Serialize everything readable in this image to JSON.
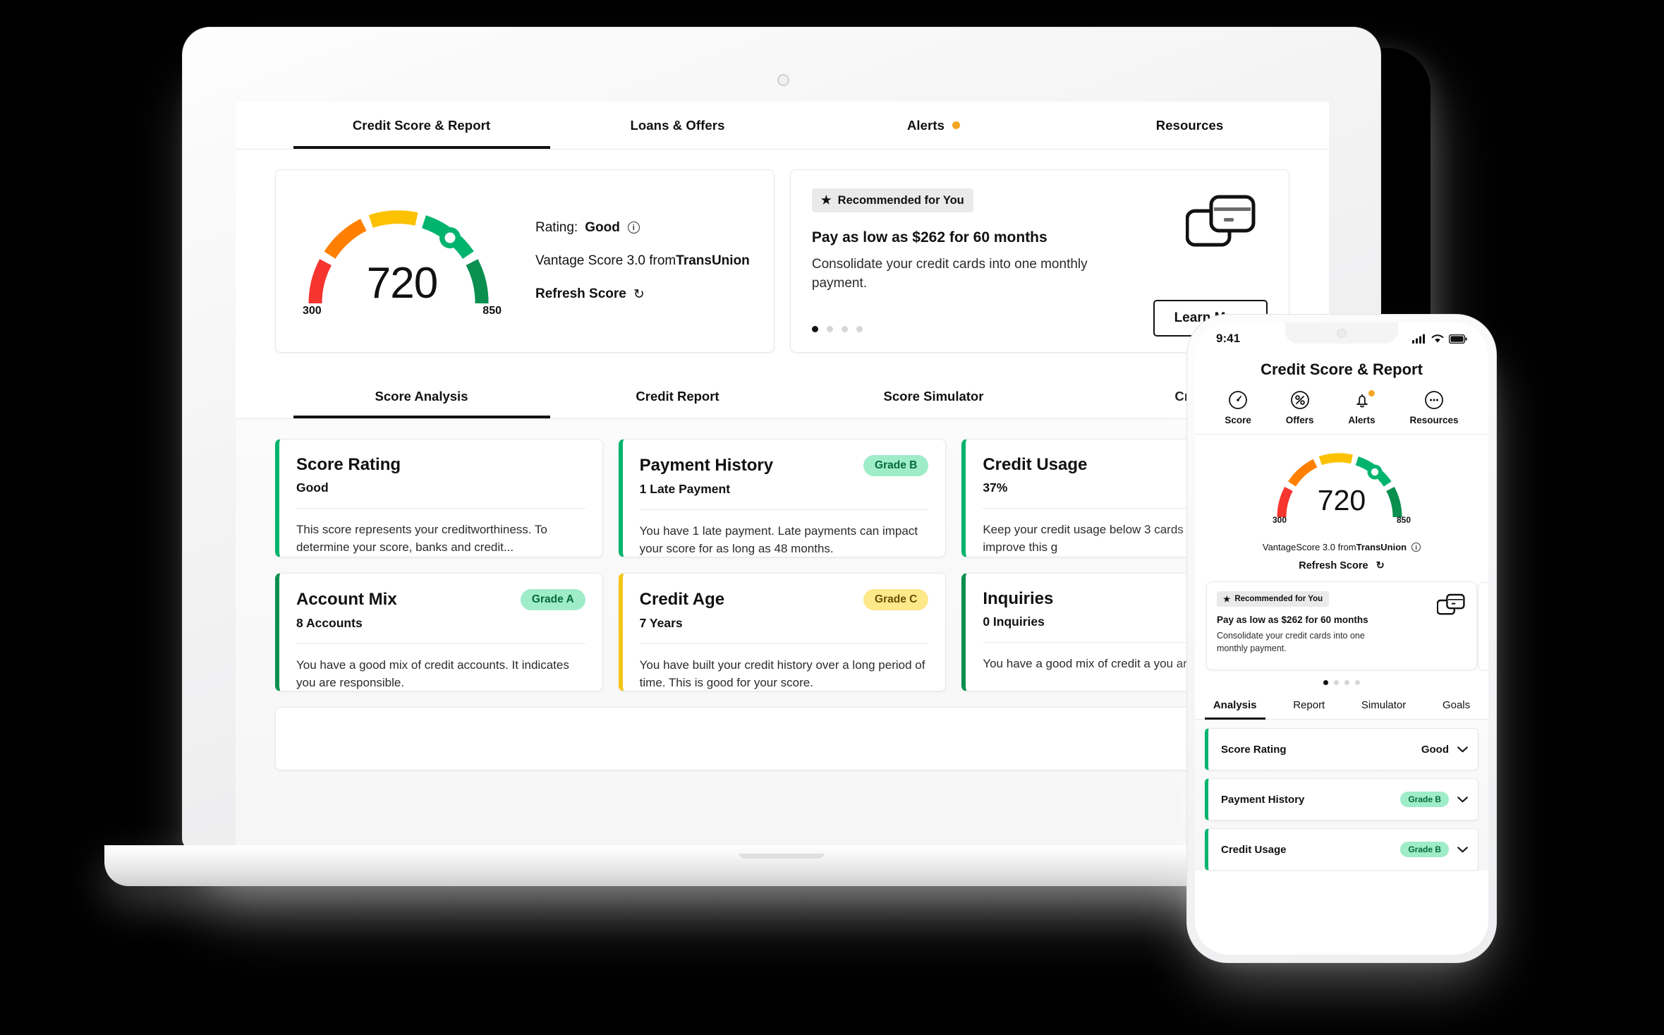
{
  "desktop": {
    "top_tabs": [
      {
        "label": "Credit Score & Report",
        "active": true,
        "dot": false
      },
      {
        "label": "Loans & Offers",
        "active": false,
        "dot": false
      },
      {
        "label": "Alerts",
        "active": false,
        "dot": true
      },
      {
        "label": "Resources",
        "active": false,
        "dot": false
      }
    ],
    "score_panel": {
      "score": "720",
      "min_label": "300",
      "max_label": "850",
      "rating_label": "Rating:",
      "rating_value": "Good",
      "info_icon": "info-icon",
      "bureau_text_light": "Vantage Score 3.0 from ",
      "bureau_text_bold": "TransUnion",
      "refresh_label": "Refresh Score",
      "refresh_icon": "refresh-icon"
    },
    "offer_panel": {
      "badge_icon": "star-icon",
      "badge_label": "Recommended for You",
      "title": "Pay as low as $262 for 60 months",
      "description": "Consolidate your credit cards into one monthly payment.",
      "cta_label": "Learn More",
      "card_icon": "credit-cards-icon",
      "dots_total": 4,
      "dots_active": 1
    },
    "sub_tabs": [
      {
        "label": "Score Analysis",
        "active": true
      },
      {
        "label": "Credit Report",
        "active": false
      },
      {
        "label": "Score Simulator",
        "active": false
      },
      {
        "label": "Cred",
        "active": false
      }
    ],
    "factor_cards": [
      {
        "title": "Score Rating",
        "value": "Good",
        "grade": "",
        "accent": "#00b46e",
        "grade_bg": "",
        "grade_fg": "",
        "description": "This score represents your creditworthiness. To determine your score, banks and credit..."
      },
      {
        "title": "Payment History",
        "value": "1 Late Payment",
        "grade": "Grade B",
        "accent": "#00b46e",
        "grade_bg": "#9fecc8",
        "grade_fg": "#056b38",
        "description": "You have 1 late payment. Late payments can impact your score for as long as 48 months."
      },
      {
        "title": "Credit Usage",
        "value": "37%",
        "grade": "",
        "accent": "#00b46e",
        "grade_bg": "",
        "grade_fg": "",
        "description": "Keep your credit usage below 3 cards in order to improve this g"
      },
      {
        "title": "Account Mix",
        "value": "8 Accounts",
        "grade": "Grade A",
        "accent": "#0a8f4f",
        "grade_bg": "#9fecc8",
        "grade_fg": "#056b38",
        "description": "You have a good mix of credit accounts. It indicates you are responsible."
      },
      {
        "title": "Credit Age",
        "value": "7 Years",
        "grade": "Grade C",
        "accent": "#f5c518",
        "grade_bg": "#fde88a",
        "grade_fg": "#6b4e05",
        "description": "You have built your credit history over a long period of time. This is good for your score."
      },
      {
        "title": "Inquiries",
        "value": "0 Inquiries",
        "grade": "",
        "accent": "#0a8f4f",
        "grade_bg": "",
        "grade_fg": "",
        "description": "You have a good mix of credit a you are responsible."
      }
    ]
  },
  "phone": {
    "status": {
      "time": "9:41",
      "signal_icon": "cellular-signal-icon",
      "wifi_icon": "wifi-icon",
      "battery_icon": "battery-icon"
    },
    "title": "Credit Score & Report",
    "nav_icons": [
      {
        "label": "Score",
        "icon": "speedometer-icon",
        "badge": false
      },
      {
        "label": "Offers",
        "icon": "percent-icon",
        "badge": false
      },
      {
        "label": "Alerts",
        "icon": "bell-icon",
        "badge": true
      },
      {
        "label": "Resources",
        "icon": "ellipsis-icon",
        "badge": false
      }
    ],
    "score_panel": {
      "score": "720",
      "min_label": "300",
      "max_label": "850",
      "bureau_text_light": "VantageScore 3.0 from ",
      "bureau_text_bold": "TransUnion",
      "info_icon": "info-icon",
      "refresh_label": "Refresh Score",
      "refresh_icon": "refresh-icon"
    },
    "offer": {
      "badge_icon": "star-icon",
      "badge_label": "Recommended for You",
      "title": "Pay as low as $262 for 60 months",
      "description": "Consolidate your credit cards into one monthly payment.",
      "card_icon": "credit-cards-icon",
      "dots_total": 4,
      "dots_active": 1
    },
    "tabs": [
      {
        "label": "Analysis",
        "active": true
      },
      {
        "label": "Report",
        "active": false
      },
      {
        "label": "Simulator",
        "active": false
      },
      {
        "label": "Goals",
        "active": false
      }
    ],
    "rows": [
      {
        "title": "Score Rating",
        "value": "Good",
        "grade": "",
        "accent": "#00b46e",
        "grade_bg": "",
        "grade_fg": ""
      },
      {
        "title": "Payment History",
        "value": "",
        "grade": "Grade B",
        "accent": "#00b46e",
        "grade_bg": "#9fecc8",
        "grade_fg": "#056b38"
      },
      {
        "title": "Credit Usage",
        "value": "",
        "grade": "Grade B",
        "accent": "#00b46e",
        "grade_bg": "#9fecc8",
        "grade_fg": "#056b38"
      }
    ]
  },
  "gauge": {
    "segments": [
      {
        "name": "poor",
        "color": "#f6352f"
      },
      {
        "name": "fair",
        "color": "#ff8000"
      },
      {
        "name": "good-low",
        "color": "#fcc202"
      },
      {
        "name": "good",
        "color": "#00b46e"
      },
      {
        "name": "excellent",
        "color": "#0a8f4f"
      }
    ],
    "needle_position": "good"
  }
}
